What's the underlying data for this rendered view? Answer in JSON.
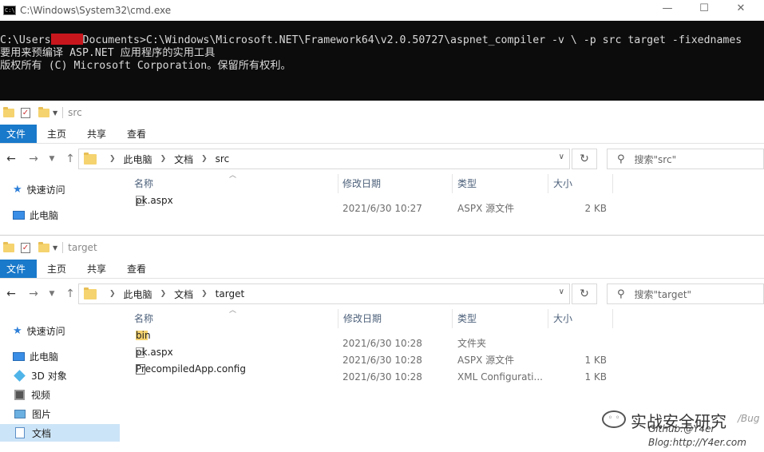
{
  "cmd": {
    "title": "C:\\Windows\\System32\\cmd.exe",
    "icon_label": "C:\\",
    "line1_prefix": "C:\\Users",
    "line1_suffix": "Documents>C:\\Windows\\Microsoft.NET\\Framework64\\v2.0.50727\\aspnet_compiler -v \\ -p src target -fixednames",
    "line2": "要用来预编译 ASP.NET 应用程序的实用工具",
    "line3": "版权所有 (C) Microsoft Corporation。保留所有权利。",
    "redact_color": "#c8161d",
    "min_glyph": "—",
    "max_glyph": "☐",
    "close_glyph": "✕"
  },
  "explorer_top": {
    "title": "src",
    "ribbon": [
      "文件",
      "主页",
      "共享",
      "查看"
    ],
    "breadcrumb": [
      "此电脑",
      "文档",
      "src"
    ],
    "search_placeholder": "搜索\"src\"",
    "nav": [
      {
        "label": "快速访问",
        "icon": "star-icon"
      },
      {
        "label": "此电脑",
        "icon": "computer-icon"
      }
    ],
    "columns": [
      "名称",
      "修改日期",
      "类型",
      "大小"
    ],
    "files": [
      {
        "name": "pk.aspx",
        "date": "2021/6/30 10:27",
        "type": "ASPX 源文件",
        "size": "2 KB",
        "icon": "aspx-file-icon"
      }
    ]
  },
  "explorer_bottom": {
    "title": "target",
    "ribbon": [
      "文件",
      "主页",
      "共享",
      "查看"
    ],
    "breadcrumb": [
      "此电脑",
      "文档",
      "target"
    ],
    "search_placeholder": "搜索\"target\"",
    "nav": [
      {
        "label": "快速访问",
        "icon": "star-icon"
      },
      {
        "label": "此电脑",
        "icon": "computer-icon"
      },
      {
        "label": "3D 对象",
        "icon": "3d-objects-icon"
      },
      {
        "label": "视频",
        "icon": "video-icon"
      },
      {
        "label": "图片",
        "icon": "pictures-icon"
      },
      {
        "label": "文档",
        "icon": "documents-icon",
        "selected": true
      }
    ],
    "columns": [
      "名称",
      "修改日期",
      "类型",
      "大小"
    ],
    "files": [
      {
        "name": "bin",
        "date": "2021/6/30 10:28",
        "type": "文件夹",
        "size": "",
        "icon": "folder-icon"
      },
      {
        "name": "pk.aspx",
        "date": "2021/6/30 10:28",
        "type": "ASPX 源文件",
        "size": "1 KB",
        "icon": "aspx-file-icon"
      },
      {
        "name": "PrecompiledApp.config",
        "date": "2021/6/30 10:28",
        "type": "XML Configurati...",
        "size": "1 KB",
        "icon": "config-file-icon"
      }
    ]
  },
  "watermark": {
    "title": "实战安全研究",
    "github": "Github:@Y4er",
    "blog": "Blog:http://Y4er.com",
    "tag": "/Bug"
  },
  "colors": {
    "file_tab": "#1979ca",
    "selected_nav": "#cce4f7",
    "cmd_bg": "#0c0c0c"
  }
}
